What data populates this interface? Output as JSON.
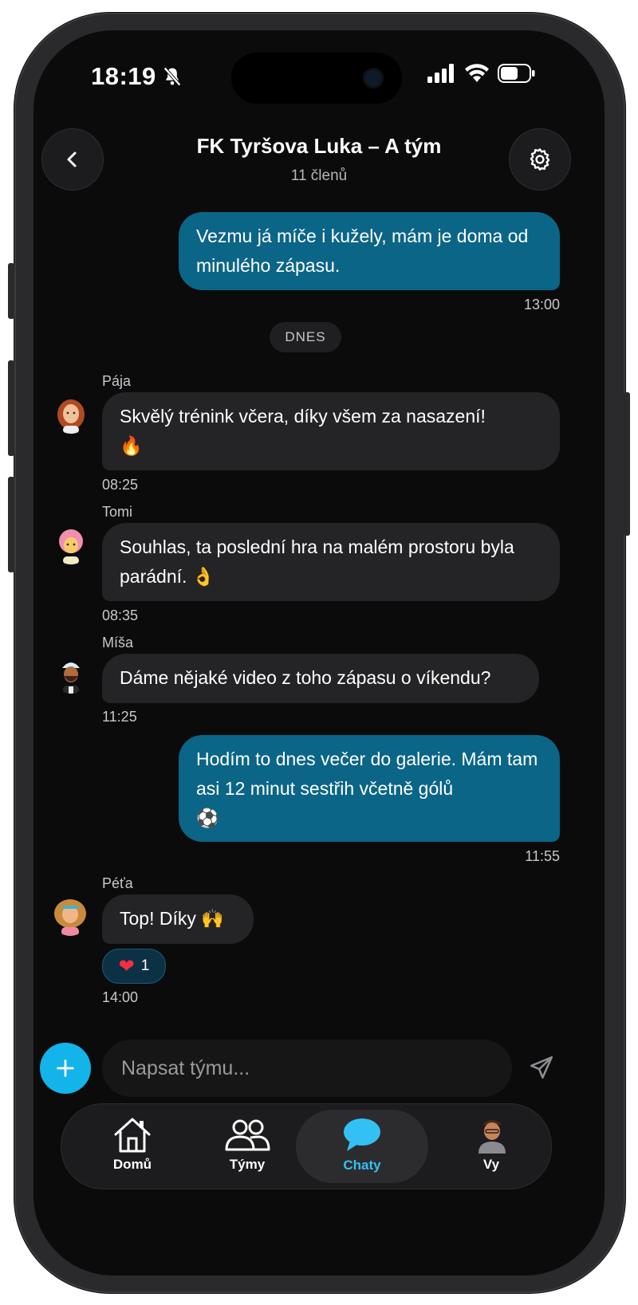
{
  "status_bar": {
    "time": "18:19"
  },
  "header": {
    "title": "FK Tyršova Luka – A tým",
    "subtitle": "11 členů"
  },
  "day_separator": "DNES",
  "messages": [
    {
      "text": "Vezmu já míče i kužely, mám je doma od minulého zápasu.",
      "time": "13:00"
    },
    {
      "sender": "Pája",
      "text": "Skvělý trénink včera, díky všem za nasazení!",
      "emoji": "🔥",
      "time": "08:25"
    },
    {
      "sender": "Tomi",
      "text": "Souhlas, ta poslední hra na malém prostoru byla parádní.",
      "emoji": "👌",
      "time": "08:35"
    },
    {
      "sender": "Míša",
      "text": "Dáme nějaké video z toho zápasu o víkendu?",
      "time": "11:25"
    },
    {
      "text": "Hodím to dnes večer do galerie. Mám tam asi 12 minut sestřih včetně gólů",
      "emoji": "⚽",
      "time": "11:55"
    },
    {
      "sender": "Péťa",
      "text": "Top! Díky",
      "emoji": "🙌",
      "time": "14:00",
      "reaction": {
        "emoji": "❤",
        "count": "1"
      }
    }
  ],
  "composer": {
    "placeholder": "Napsat týmu..."
  },
  "tabs": [
    {
      "label": "Domů",
      "icon": "home-icon"
    },
    {
      "label": "Týmy",
      "icon": "people-icon"
    },
    {
      "label": "Chaty",
      "icon": "chat-bubble-icon",
      "active": true
    },
    {
      "label": "Vy",
      "icon": "profile-avatar"
    }
  ],
  "colors": {
    "accent": "#12b4ea",
    "outgoing_bubble": "#0b6587",
    "incoming_bubble": "#242426",
    "active_tab": "#33c1f3"
  }
}
